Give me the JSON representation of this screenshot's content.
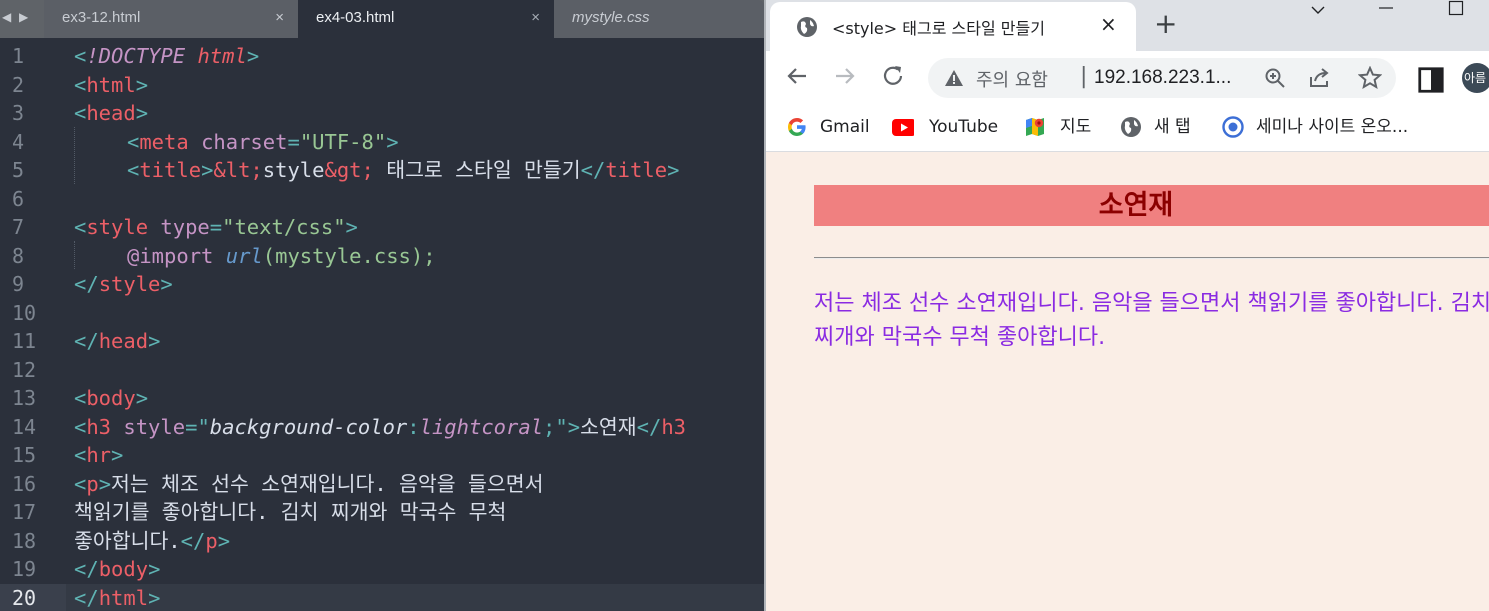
{
  "editor": {
    "tabs": [
      {
        "label": "ex3-12.html",
        "close": "×"
      },
      {
        "label": "ex4-03.html",
        "close": "×"
      },
      {
        "label": "mystyle.css"
      }
    ],
    "line_numbers": [
      "1",
      "2",
      "3",
      "4",
      "5",
      "6",
      "7",
      "8",
      "9",
      "10",
      "11",
      "12",
      "13",
      "14",
      "15",
      "16",
      "17",
      "18",
      "19",
      "20"
    ],
    "active_line": "20",
    "code": {
      "l1_doctype": "!DOCTYPE",
      "l1_html": "html",
      "l2_tag": "html",
      "l3_tag": "head",
      "l4_tag": "meta",
      "l4_attr": "charset",
      "l4_val": "\"UTF-8\"",
      "l5_tag": "title",
      "l5_ent1": "&lt;",
      "l5_text1": "style",
      "l5_ent2": "&gt;",
      "l5_text2": " 태그로 스타일 만들기",
      "l7_tag": "style",
      "l7_attr": "type",
      "l7_val": "\"text/css\"",
      "l8_at": "@import",
      "l8_fn": "url",
      "l8_arg": "(mystyle.css);",
      "l9_tag": "style",
      "l11_tag": "head",
      "l13_tag": "body",
      "l14_tag": "h3",
      "l14_attr": "style",
      "l14_prop": "background-color",
      "l14_value": "lightcoral",
      "l14_text": "소연재",
      "l15_tag": "hr",
      "l16_tag": "p",
      "l16_text": "저는 체조 선수 소연재입니다. 음악을 들으면서",
      "l17_text": "책읽기를 좋아합니다. 김치 찌개와 막국수 무척",
      "l18_text": "좋아합니다.",
      "l18_tag": "p",
      "l19_tag": "body",
      "l20_tag": "html"
    }
  },
  "browser": {
    "tab_title": "<style> 태그로 스타일 만들기",
    "tab_close": "×",
    "new_tab": "+",
    "omnibox": {
      "security_label": "주의 요함",
      "url": "192.168.223.1..."
    },
    "avatar_label": "아름",
    "bookmarks": [
      {
        "label": "Gmail"
      },
      {
        "label": "YouTube"
      },
      {
        "label": "지도"
      },
      {
        "label": "새 탭"
      },
      {
        "label": "세미나 사이트 온오..."
      }
    ],
    "page": {
      "heading": "소연재",
      "paragraph": "저는 체조 선수 소연재입니다. 음악을 들으면서 책읽기를 좋아합니다. 김치 찌개와 막국수 무척 좋아합니다.",
      "heading_background": "#f08080",
      "heading_color": "#8b0000",
      "paragraph_color": "#8a2be2",
      "background": "#faeee6"
    }
  }
}
